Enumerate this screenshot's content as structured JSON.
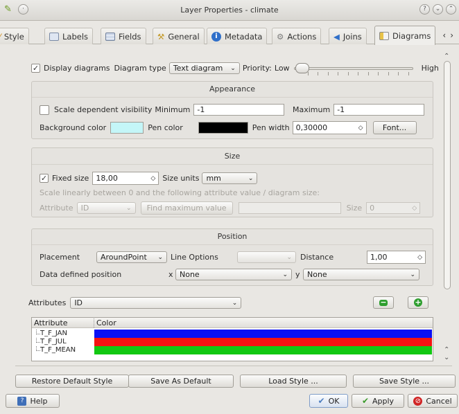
{
  "window": {
    "title": "Layer Properties - climate"
  },
  "tabs": [
    {
      "label": "Style",
      "icon": "style-icon"
    },
    {
      "label": "Labels",
      "icon": "labels-icon"
    },
    {
      "label": "Fields",
      "icon": "fields-icon"
    },
    {
      "label": "General",
      "icon": "general-icon"
    },
    {
      "label": "Metadata",
      "icon": "metadata-icon"
    },
    {
      "label": "Actions",
      "icon": "actions-icon"
    },
    {
      "label": "Joins",
      "icon": "joins-icon"
    },
    {
      "label": "Diagrams",
      "icon": "diagrams-icon",
      "active": true
    }
  ],
  "diagram": {
    "display_label": "Display diagrams",
    "display_checked": true,
    "type_label": "Diagram type",
    "type_value": "Text diagram",
    "priority_label": "Priority:",
    "priority_low": "Low",
    "priority_high": "High",
    "priority_value": 0
  },
  "appearance": {
    "title": "Appearance",
    "scale_label": "Scale dependent visibility",
    "scale_checked": false,
    "min_label": "Minimum",
    "min_value": "-1",
    "max_label": "Maximum",
    "max_value": "-1",
    "bg_label": "Background color",
    "bg_color": "#c4f6f8",
    "pen_label": "Pen color",
    "pen_color": "#000000",
    "pen_width_label": "Pen width",
    "pen_width_value": "0,30000",
    "font_button": "Font..."
  },
  "size": {
    "title": "Size",
    "fixed_label": "Fixed size",
    "fixed_checked": true,
    "fixed_value": "18,00",
    "units_label": "Size units",
    "units_value": "mm",
    "scale_text": "Scale linearly between 0 and the following attribute value / diagram size:",
    "attr_label": "Attribute",
    "attr_value": "ID",
    "find_max_button": "Find maximum value",
    "size_label": "Size",
    "size_value": "0"
  },
  "position": {
    "title": "Position",
    "placement_label": "Placement",
    "placement_value": "AroundPoint",
    "line_options_label": "Line Options",
    "line_options_value": "",
    "distance_label": "Distance",
    "distance_value": "1,00",
    "ddp_label": "Data defined position",
    "x_label": "x",
    "x_value": "None",
    "y_label": "y",
    "y_value": "None"
  },
  "attributes": {
    "label": "Attributes",
    "value": "ID",
    "col_attribute": "Attribute",
    "col_color": "Color",
    "rows": [
      {
        "name": "T_F_JAN",
        "color": "#0a10f5"
      },
      {
        "name": "T_F_JUL",
        "color": "#f51212"
      },
      {
        "name": "T_F_MEAN",
        "color": "#12c812"
      }
    ]
  },
  "style_buttons": {
    "restore": "Restore Default Style",
    "save_default": "Save As Default",
    "load": "Load Style ...",
    "save": "Save Style ..."
  },
  "footer": {
    "help": "Help",
    "ok": "OK",
    "apply": "Apply",
    "cancel": "Cancel"
  }
}
